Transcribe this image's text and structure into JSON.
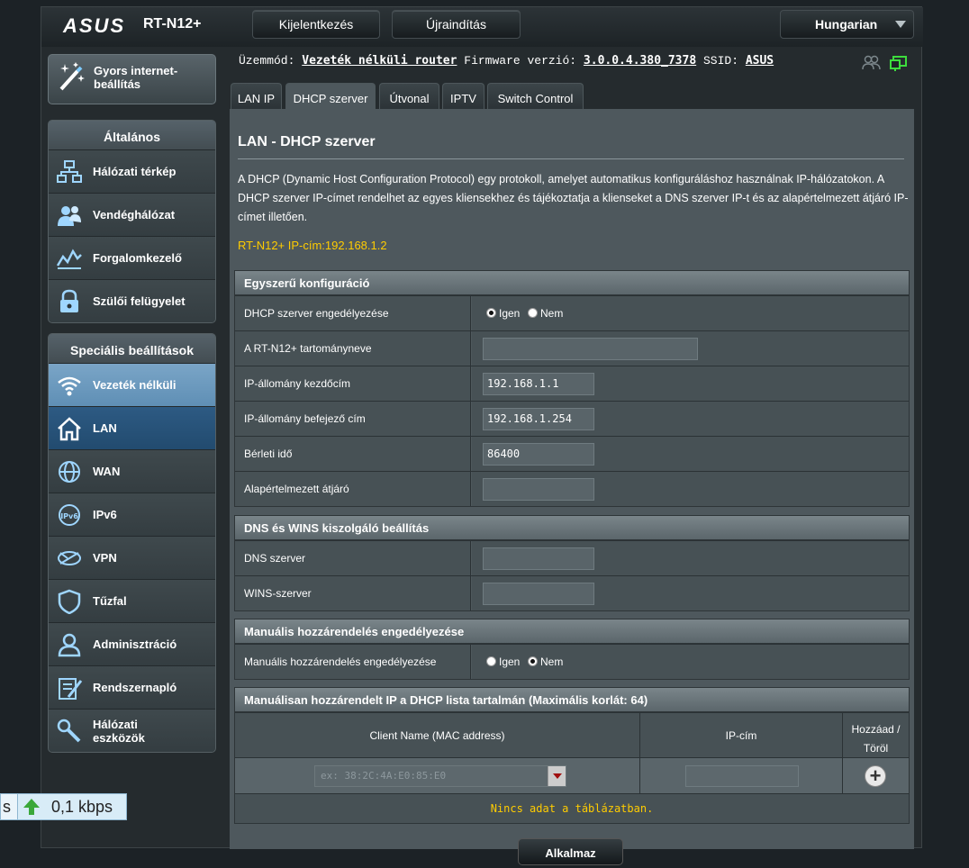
{
  "header": {
    "brand": "ASUS",
    "model": "RT-N12+",
    "logout_label": "Kijelentkezés",
    "reboot_label": "Újraindítás",
    "language": "Hungarian"
  },
  "sidebar": {
    "quick_setup": "Gyors internet-beállítás",
    "quick_setup_line1": "Gyors internet-",
    "quick_setup_line2": "beállítás",
    "general_title": "Általános",
    "general_items": [
      {
        "label": "Hálózati térkép",
        "icon": "network-map-icon"
      },
      {
        "label": "Vendéghálózat",
        "icon": "guest-network-icon"
      },
      {
        "label": "Forgalomkezelő",
        "icon": "traffic-manager-icon"
      },
      {
        "label": "Szülői felügyelet",
        "icon": "parental-control-icon"
      }
    ],
    "advanced_title": "Speciális beállítások",
    "advanced_items": [
      {
        "label": "Vezeték nélküli",
        "icon": "wifi-icon"
      },
      {
        "label": "LAN",
        "icon": "home-icon"
      },
      {
        "label": "WAN",
        "icon": "globe-icon"
      },
      {
        "label": "IPv6",
        "icon": "ipv6-icon"
      },
      {
        "label": "VPN",
        "icon": "vpn-icon"
      },
      {
        "label": "Tűzfal",
        "icon": "firewall-shield-icon"
      },
      {
        "label": "Adminisztráció",
        "icon": "admin-user-icon"
      },
      {
        "label": "Rendszernapló",
        "icon": "system-log-icon"
      },
      {
        "label_line1": "Hálózati",
        "label_line2": "eszközök",
        "icon": "network-tools-icon"
      }
    ]
  },
  "status": {
    "mode_label": "Üzemmód:",
    "mode_value": "Vezeték nélküli router",
    "fw_label": "Firmware verzió:",
    "fw_value": "3.0.0.4.380_7378",
    "ssid_label": "SSID:",
    "ssid_value": "ASUS"
  },
  "tabs": [
    "LAN IP",
    "DHCP szerver",
    "Útvonal",
    "IPTV",
    "Switch Control"
  ],
  "page": {
    "title": "LAN - DHCP szerver",
    "description": "A DHCP (Dynamic Host Configuration Protocol) egy protokoll, amelyet automatikus konfiguráláshoz használnak IP-hálózatokon. A DHCP szerver IP-címet rendelhet az egyes kliensekhez és tájékoztatja a klienseket a DNS szerver IP-t és az alapértelmezett átjáró IP-címet illetően.",
    "router_ip": "RT-N12+ IP-cím:192.168.1.2"
  },
  "basic": {
    "title": "Egyszerű konfiguráció",
    "enable_label": "DHCP szerver engedélyezése",
    "yes": "Igen",
    "no": "Nem",
    "domain_label": "A RT-N12+ tartományneve",
    "domain_value": "",
    "start_label": "IP-állomány kezdőcím",
    "start_value": "192.168.1.1",
    "end_label": "IP-állomány befejező cím",
    "end_value": "192.168.1.254",
    "lease_label": "Bérleti idő",
    "lease_value": "86400",
    "gateway_label": "Alapértelmezett átjáró",
    "gateway_value": ""
  },
  "dns": {
    "title": "DNS és WINS kiszolgáló beállítás",
    "dns_label": "DNS szerver",
    "dns_value": "",
    "wins_label": "WINS-szerver",
    "wins_value": ""
  },
  "manual": {
    "title": "Manuális hozzárendelés engedélyezése",
    "label": "Manuális hozzárendelés engedélyezése",
    "yes": "Igen",
    "no": "Nem"
  },
  "list": {
    "title": "Manuálisan hozzárendelt IP a DHCP lista tartalmán (Maximális korlát: 64)",
    "col_client": "Client Name (MAC address)",
    "col_ip": "IP-cím",
    "col_add_line1": "Hozzáad /",
    "col_add_line2": "Töröl",
    "mac_placeholder": "ex: 38:2C:4A:E0:85:E0",
    "no_data": "Nincs adat a táblázatban."
  },
  "apply_label": "Alkalmaz",
  "netmeter": {
    "left_text": "s",
    "value": "0,1 kbps"
  }
}
